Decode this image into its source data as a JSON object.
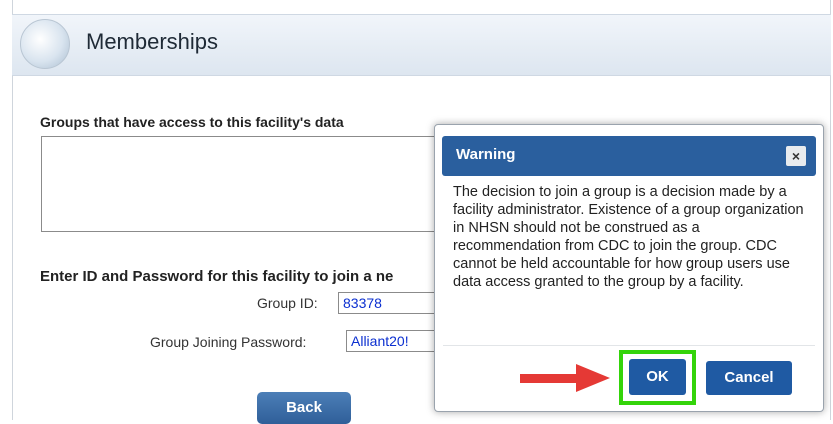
{
  "header": {
    "title": "Memberships"
  },
  "groups": {
    "label": "Groups that have access to this facility's data"
  },
  "join": {
    "label": "Enter ID and Password for this facility to join a ne",
    "group_id_label": "Group ID:",
    "group_id_value": "83378",
    "password_label": "Group Joining Password:",
    "password_value": "Alliant20!",
    "back_label": "Back"
  },
  "dialog": {
    "title": "Warning",
    "close_label": "×",
    "message": "The decision to join a group is a decision made by a facility administrator. Existence of a group organization in NHSN should not be construed as a recommendation from CDC to join the group. CDC cannot be held accountable for how group users use data access granted to the group by a facility.",
    "ok_label": "OK",
    "cancel_label": "Cancel"
  },
  "colors": {
    "dialog_title_bg": "#2a5f9e",
    "button_bg": "#1f5aa3",
    "highlight": "#34d40a",
    "arrow": "#e53935"
  }
}
